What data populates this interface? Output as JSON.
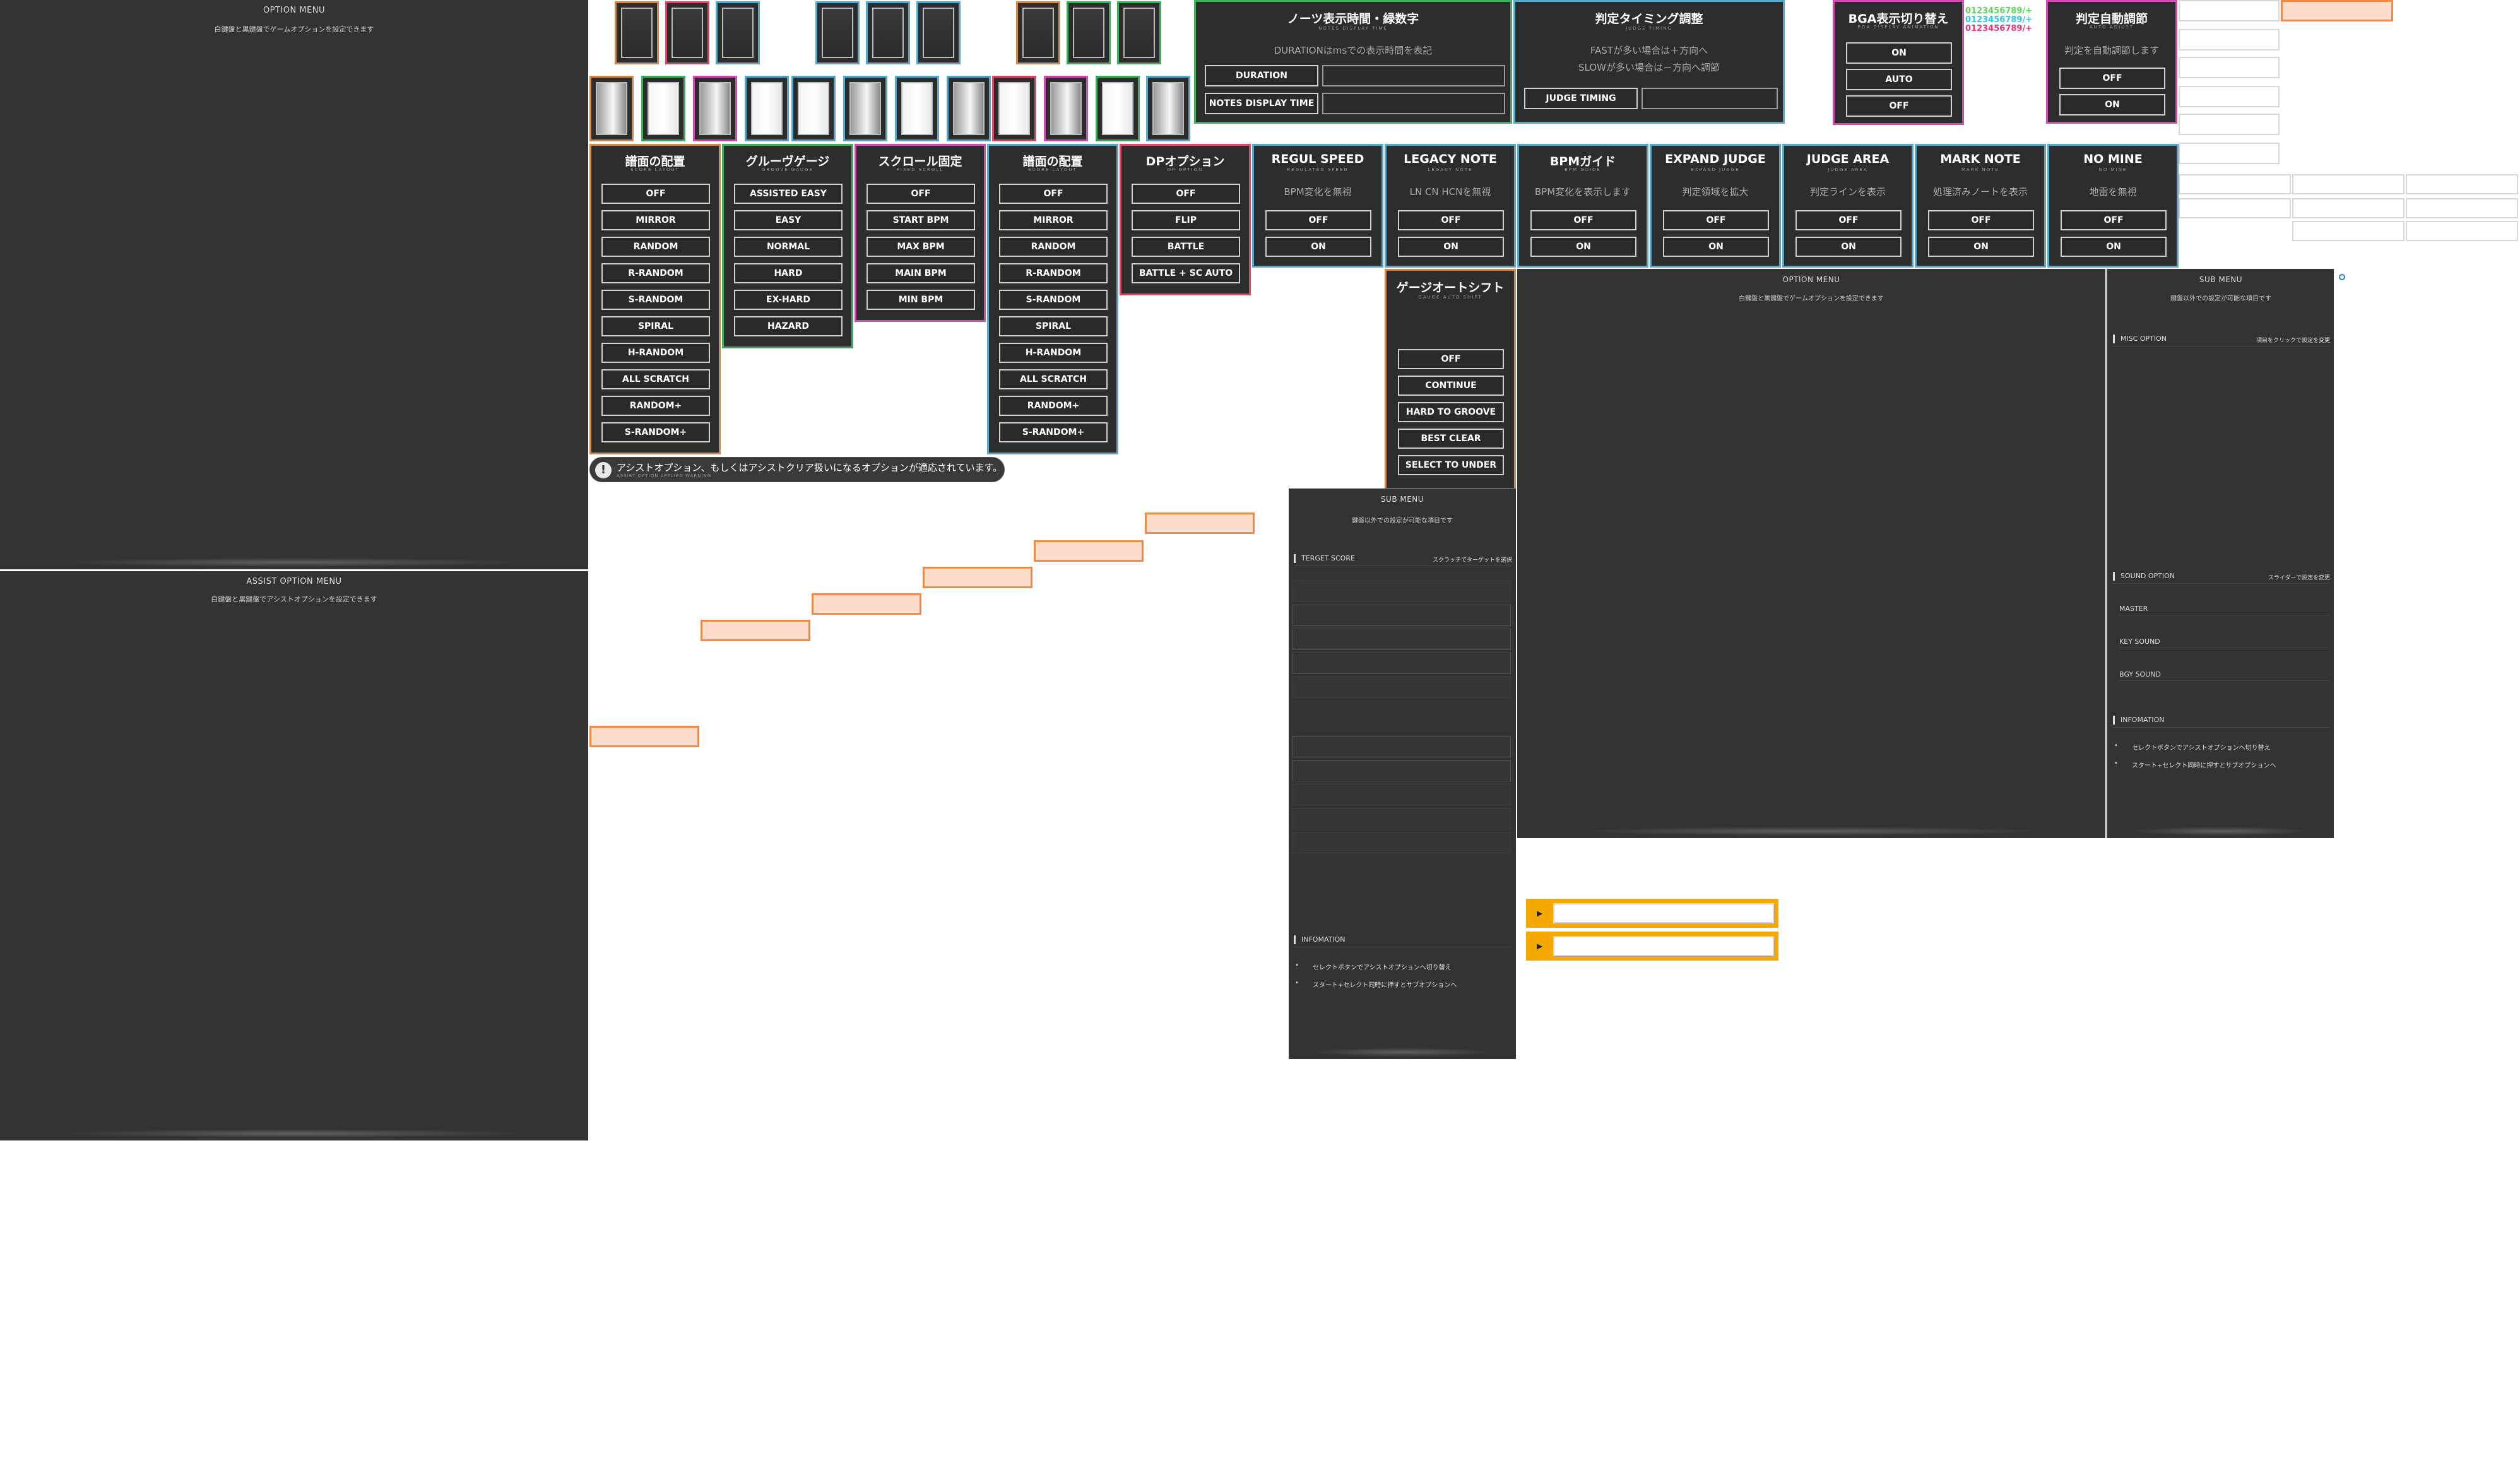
{
  "left_panels": {
    "option_menu": {
      "title": "OPTION MENU",
      "subtitle": "白鍵盤と黒鍵盤でゲームオプションを設定できます"
    },
    "assist_menu": {
      "title": "ASSIST OPTION MENU",
      "subtitle": "白鍵盤と黒鍵盤でアシストオプションを設定できます"
    }
  },
  "colors": {
    "background": "#ffffff",
    "panel": "#333333",
    "orange": "#f08a4b",
    "yellow": "#f4a800",
    "cyan": "#5aa8c8",
    "pink": "#d24bb0",
    "green": "#3fae5f"
  },
  "panels": {
    "score_layout": {
      "title": "譜面の配置",
      "sub": "SCORE LAYOUT",
      "options": [
        "OFF",
        "MIRROR",
        "RANDOM",
        "R-RANDOM",
        "S-RANDOM",
        "SPIRAL",
        "H-RANDOM",
        "ALL SCRATCH",
        "RANDOM+",
        "S-RANDOM+"
      ]
    },
    "groove_gauge": {
      "title": "グルーヴゲージ",
      "sub": "GROOVE GAUGE",
      "options": [
        "ASSISTED EASY",
        "EASY",
        "NORMAL",
        "HARD",
        "EX-HARD",
        "HAZARD"
      ]
    },
    "scroll_fix": {
      "title": "スクロール固定",
      "sub": "FIXED SCROLL",
      "options": [
        "OFF",
        "START BPM",
        "MAX BPM",
        "MAIN BPM",
        "MIN BPM"
      ]
    },
    "score_layout_2p": {
      "title": "譜面の配置",
      "sub": "SCORE LAYOUT",
      "options": [
        "OFF",
        "MIRROR",
        "RANDOM",
        "R-RANDOM",
        "S-RANDOM",
        "SPIRAL",
        "H-RANDOM",
        "ALL SCRATCH",
        "RANDOM+",
        "S-RANDOM+"
      ]
    },
    "dp_option": {
      "title": "DPオプション",
      "sub": "DP OPTION",
      "options": [
        "OFF",
        "FLIP",
        "BATTLE",
        "BATTLE + SC AUTO"
      ]
    },
    "regul_speed": {
      "title": "REGUL SPEED",
      "sub": "REGULATED SPEED",
      "desc": "BPM変化を無視",
      "options": [
        "OFF",
        "ON"
      ]
    },
    "legacy_note": {
      "title": "LEGACY NOTE",
      "sub": "LEGACY NOTE",
      "desc": "LN CN HCNを無視",
      "options": [
        "OFF",
        "ON"
      ]
    },
    "bpm_guide": {
      "title": "BPMガイド",
      "sub": "BPM GUIDE",
      "desc": "BPM変化を表示します",
      "options": [
        "OFF",
        "ON"
      ]
    },
    "expand_judge": {
      "title": "EXPAND JUDGE",
      "sub": "EXPAND JUDGE",
      "desc": "判定領域を拡大",
      "options": [
        "OFF",
        "ON"
      ]
    },
    "judge_area": {
      "title": "JUDGE AREA",
      "sub": "JUDGE AREA",
      "desc": "判定ラインを表示",
      "options": [
        "OFF",
        "ON"
      ]
    },
    "mark_note": {
      "title": "MARK NOTE",
      "sub": "MARK NOTE",
      "desc": "処理済みノートを表示",
      "options": [
        "OFF",
        "ON"
      ]
    },
    "no_mine": {
      "title": "NO MINE",
      "sub": "NO MINE",
      "desc": "地雷を無視",
      "options": [
        "OFF",
        "ON"
      ]
    },
    "gauge_autoshift": {
      "title": "ゲージオートシフト",
      "sub": "GAUGE AUTO SHIFT",
      "options": [
        "OFF",
        "CONTINUE",
        "HARD TO GROOVE",
        "BEST CLEAR",
        "SELECT TO UNDER"
      ]
    },
    "notes_display": {
      "title": "ノーツ表示時間・緑数字",
      "sub": "NOTES DISPLAY TIME",
      "desc": "DURATIONはmsでの表示時間を表記",
      "rows": [
        "DURATION",
        "NOTES DISPLAY TIME"
      ]
    },
    "judge_timing": {
      "title": "判定タイミング調整",
      "sub": "JUDGE TIMING",
      "desc1": "FASTが多い場合は＋方向へ",
      "desc2": "SLOWが多い場合は－方向へ調節",
      "row": "JUDGE TIMING"
    },
    "bga_switch": {
      "title": "BGA表示切り替え",
      "sub": "BGA DISPLAY ANIMATION",
      "options": [
        "ON",
        "AUTO",
        "OFF"
      ]
    },
    "auto_adjust": {
      "title": "判定自動調節",
      "sub": "AUTO ADJUST",
      "desc": "判定を自動調節します",
      "options": [
        "OFF",
        "ON"
      ]
    }
  },
  "digits": {
    "green": "0123456789/+",
    "cyan": "0123456789/+",
    "magenta": "0123456789/+"
  },
  "warning": {
    "text": "アシストオプション、もしくはアシストクリア扱いになるオプションが適応されています。",
    "sub": "ASSIST OPTION APPLIED WARNING"
  },
  "option_menu_center": {
    "title": "OPTION MENU",
    "subtitle": "白鍵盤と黒鍵盤でゲームオプションを設定できます"
  },
  "sub_menu_right": {
    "title": "SUB MENU",
    "subtitle": "鍵盤以外での設定が可能な項目です",
    "misc": {
      "label": "MISC OPTION",
      "hint": "項目をクリックで設定を変更"
    },
    "sound": {
      "label": "SOUND OPTION",
      "hint": "スライダーで設定を変更",
      "items": [
        "MASTER",
        "KEY SOUND",
        "BGY SOUND"
      ]
    },
    "info": {
      "label": "INFOMATION",
      "items": [
        "セレクトボタンでアシストオプションへ切り替え",
        "スタート+セレクト同時に押すとサブオプションへ"
      ]
    }
  },
  "sub_menu_mid": {
    "title": "SUB MENU",
    "subtitle": "鍵盤以外での設定が可能な項目です",
    "target": {
      "label": "TERGET SCORE",
      "hint": "スクラッチでターゲットを選択"
    },
    "info": {
      "label": "INFOMATION",
      "items": [
        "セレクトボタンでアシストオプションへ切り替え",
        "スタート+セレクト同時に押すとサブオプションへ"
      ]
    }
  }
}
